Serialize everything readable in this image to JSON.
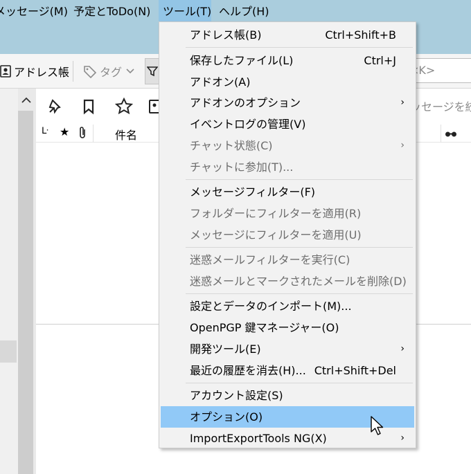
{
  "menubar": {
    "items": [
      {
        "label": "メッセージ(M)"
      },
      {
        "label": "予定とToDo(N)"
      },
      {
        "label": "ツール(T)"
      },
      {
        "label": "ヘルプ(H)"
      }
    ]
  },
  "toolbar": {
    "address_book_label": "アドレス帳",
    "tag_label": "タグ",
    "search_placeholder": "<K>"
  },
  "quick_filter": {
    "filter_placeholder": "ッセージを絞"
  },
  "message_list": {
    "columns": {
      "subject": "件名"
    }
  },
  "tools_menu": {
    "items": [
      {
        "label": "アドレス帳(B)",
        "shortcut": "Ctrl+Shift+B"
      },
      {
        "label": "保存したファイル(L)",
        "shortcut": "Ctrl+J"
      },
      {
        "label": "アドオン(A)"
      },
      {
        "label": "アドオンのオプション"
      },
      {
        "label": "イベントログの管理(V)"
      },
      {
        "label": "チャット状態(C)"
      },
      {
        "label": "チャットに参加(T)..."
      },
      {
        "label": "メッセージフィルター(F)"
      },
      {
        "label": "フォルダーにフィルターを適用(R)"
      },
      {
        "label": "メッセージにフィルターを適用(U)"
      },
      {
        "label": "迷惑メールフィルターを実行(C)"
      },
      {
        "label": "迷惑メールとマークされたメールを削除(D)"
      },
      {
        "label": "設定とデータのインポート(M)..."
      },
      {
        "label": "OpenPGP 鍵マネージャー(O)"
      },
      {
        "label": "開発ツール(E)"
      },
      {
        "label": "最近の履歴を消去(H)...",
        "shortcut": "Ctrl+Shift+Del"
      },
      {
        "label": "アカウント設定(S)"
      },
      {
        "label": "オプション(O)"
      },
      {
        "label": "ImportExportTools NG(X)"
      }
    ]
  },
  "colors": {
    "menubar_bg": "#aacddd",
    "menu_bg": "#f2f2f2",
    "highlight": "#91c9f7",
    "disabled_text": "#6d6d6d"
  }
}
